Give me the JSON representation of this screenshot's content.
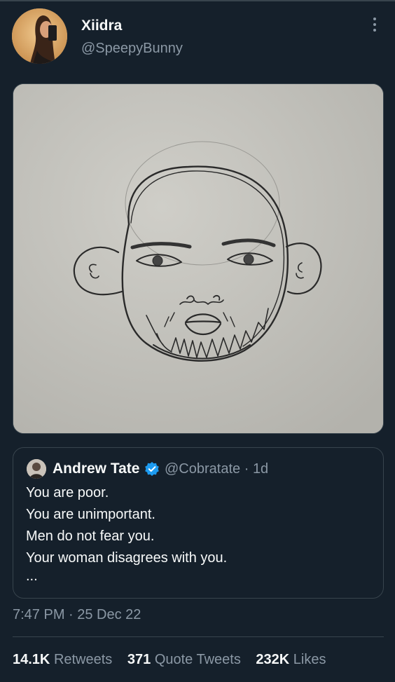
{
  "tweet": {
    "author": {
      "name": "Xiidra",
      "handle": "@SpeepyBunny"
    },
    "more_icon": "more-dots-icon",
    "media_description_icon": "face-sketch-image",
    "quote": {
      "name": "Andrew Tate",
      "verified_icon": "verified-badge-icon",
      "handle": "@Cobratate",
      "separator": "·",
      "age": "1d",
      "lines": [
        "You are poor.",
        "You are unimportant.",
        "Men do not fear you.",
        "Your woman disagrees with you.",
        "..."
      ]
    },
    "timestamp": "7:47 PM · 25 Dec 22",
    "stats": {
      "retweets_count": "14.1K",
      "retweets_label": "Retweets",
      "quotes_count": "371",
      "quotes_label": "Quote Tweets",
      "likes_count": "232K",
      "likes_label": "Likes"
    }
  },
  "colors": {
    "background": "#15202b",
    "text_primary": "#f7f9f9",
    "text_secondary": "#8b98a5",
    "border": "#38444d",
    "verified_blue": "#1d9bf0"
  }
}
